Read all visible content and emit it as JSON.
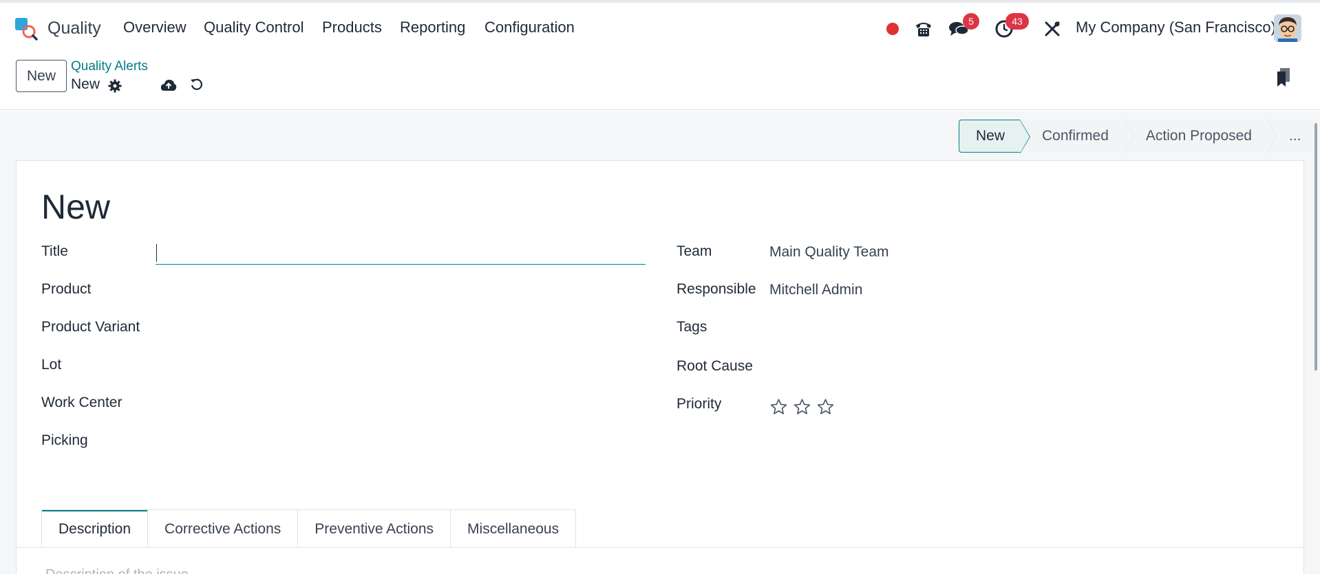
{
  "app": {
    "name": "Quality"
  },
  "menu": {
    "overview": "Overview",
    "quality_control": "Quality Control",
    "products": "Products",
    "reporting": "Reporting",
    "configuration": "Configuration"
  },
  "systray": {
    "messages_count": "5",
    "activities_count": "43",
    "company": "My Company (San Francisco)"
  },
  "control_panel": {
    "new_button": "New",
    "breadcrumb_parent": "Quality Alerts",
    "record_name": "New"
  },
  "statusbar": {
    "stages": [
      "New",
      "Confirmed",
      "Action Proposed",
      "..."
    ],
    "active": "New"
  },
  "form": {
    "record_title": "New",
    "left_fields": {
      "title": "Title",
      "product": "Product",
      "product_variant": "Product Variant",
      "lot": "Lot",
      "work_center": "Work Center",
      "picking": "Picking"
    },
    "title_value": "",
    "right_fields": {
      "team": "Team",
      "responsible": "Responsible",
      "tags": "Tags",
      "root_cause": "Root Cause",
      "priority": "Priority"
    },
    "team_value": "Main Quality Team",
    "responsible_value": "Mitchell Admin",
    "priority_value": 0,
    "priority_max": 3
  },
  "tabs": {
    "description": "Description",
    "corrective_actions": "Corrective Actions",
    "preventive_actions": "Preventive Actions",
    "miscellaneous": "Miscellaneous"
  },
  "description_placeholder": "Description of the issue...",
  "colors": {
    "accent": "#017e84",
    "badge": "#dc3545",
    "recording_dot": "#e03131"
  }
}
